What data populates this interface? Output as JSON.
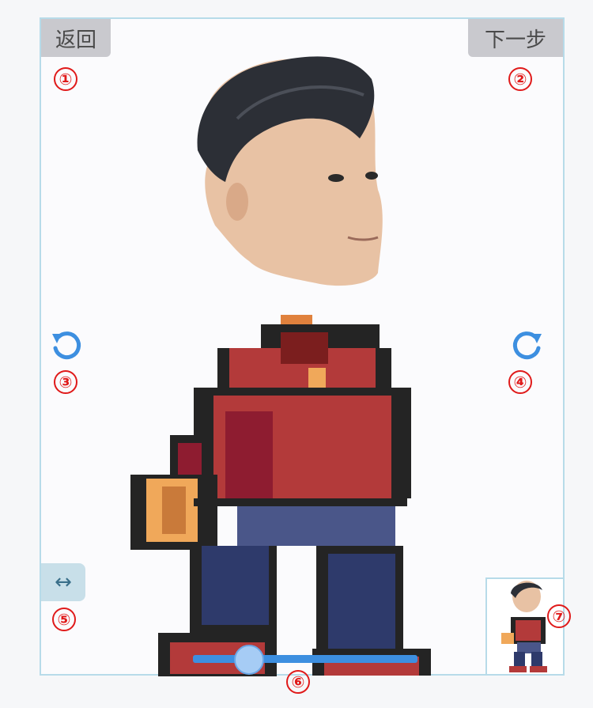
{
  "toolbar": {
    "back_label": "返回",
    "next_label": "下一步"
  },
  "markers": [
    "①",
    "②",
    "③",
    "④",
    "⑤",
    "⑥",
    "⑦"
  ],
  "icons": {
    "rotate_left": "rotate-left-icon",
    "rotate_right": "rotate-right-icon",
    "flip": "↔"
  },
  "slider": {
    "value": 0.25
  },
  "colors": {
    "accent": "#3d8fe0",
    "marker": "#e01a1a",
    "frame": "#b7dbe9"
  }
}
